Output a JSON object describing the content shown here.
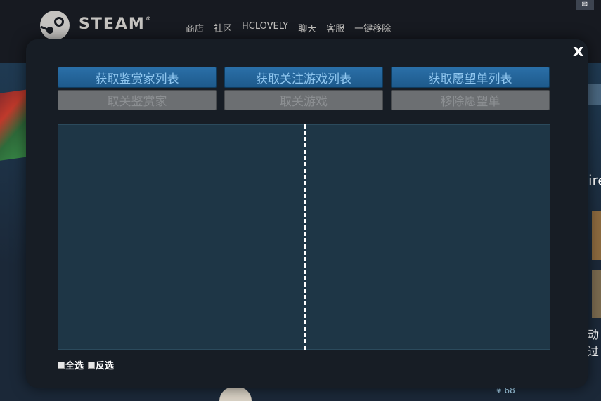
{
  "header": {
    "brand": "STEAM",
    "nav": [
      "商店",
      "社区",
      "HCLOVELY",
      "聊天",
      "客服",
      "一键移除"
    ]
  },
  "background": {
    "right_text": "ire",
    "right_text2": "动过",
    "price": "¥ 68"
  },
  "modal": {
    "close_label": "x",
    "buttons_row1": [
      "获取鉴赏家列表",
      "获取关注游戏列表",
      "获取愿望单列表"
    ],
    "buttons_row2": [
      "取关鉴赏家",
      "取关游戏",
      "移除愿望单"
    ],
    "select_all_label": "全选",
    "invert_label": "反选"
  },
  "colors": {
    "primary_button": "#2a6fa8",
    "disabled_button": "#6c6f72",
    "panel": "#1e3646"
  }
}
